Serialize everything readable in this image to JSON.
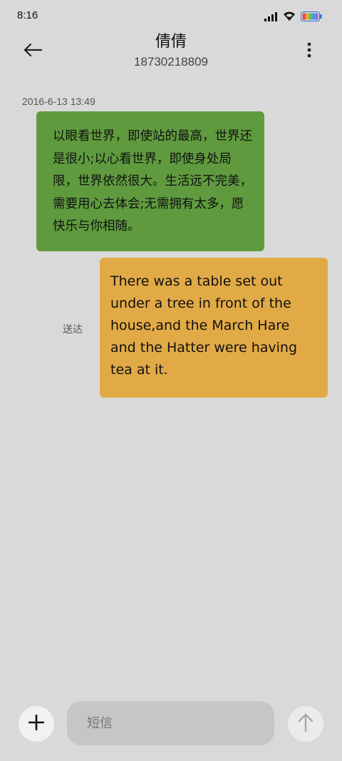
{
  "status_bar": {
    "time": "8:16",
    "icons": [
      "signal-icon",
      "wifi-icon",
      "battery-icon"
    ]
  },
  "header": {
    "contact_name": "倩倩",
    "contact_number": "18730218809",
    "back_icon": "arrow-left-icon",
    "more_icon": "more-vertical-icon"
  },
  "conversation": {
    "timestamp": "2016-6-13 13:49",
    "messages": [
      {
        "direction": "received",
        "text": "以眼看世界，即使站的最高，世界还是很小;以心看世界，即使身处局限，世界依然很大。生活远不完美，需要用心去体会;无需拥有太多，愿快乐与你相随。",
        "color": "#5f9b3e"
      },
      {
        "direction": "sent",
        "text": "There was a table set out under a tree in front of the house,and the March Hare and the Hatter were having tea at it.",
        "status": "送达",
        "color": "#e2aa46"
      }
    ]
  },
  "compose": {
    "placeholder": "短信",
    "value": "",
    "add_icon": "plus-icon",
    "send_icon": "arrow-up-icon"
  },
  "colors": {
    "background": "#d9d9d9",
    "input_background": "#c6c6c6"
  }
}
